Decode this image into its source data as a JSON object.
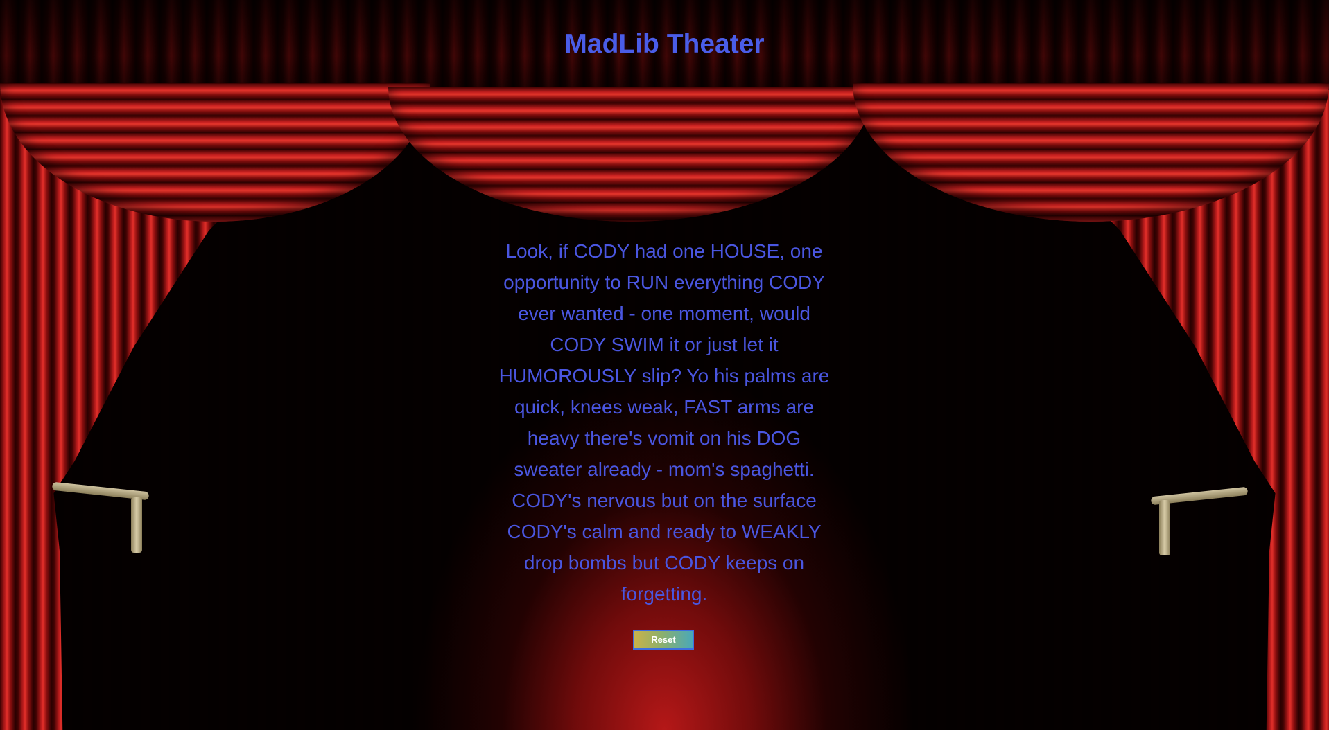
{
  "header": {
    "title": "MadLib Theater"
  },
  "story": {
    "text": "Look, if CODY had one HOUSE, one opportunity to RUN everything CODY ever wanted - one moment, would CODY SWIM it or just let it HUMOROUSLY slip? Yo his palms are quick, knees weak, FAST arms are heavy there's vomit on his DOG sweater already - mom's spaghetti. CODY's nervous but on the surface CODY's calm and ready to WEAKLY drop bombs but CODY keeps on forgetting."
  },
  "controls": {
    "reset_label": "Reset"
  },
  "colors": {
    "text_accent": "#4a5de8",
    "curtain": "#b71b1b",
    "background": "#000000"
  }
}
